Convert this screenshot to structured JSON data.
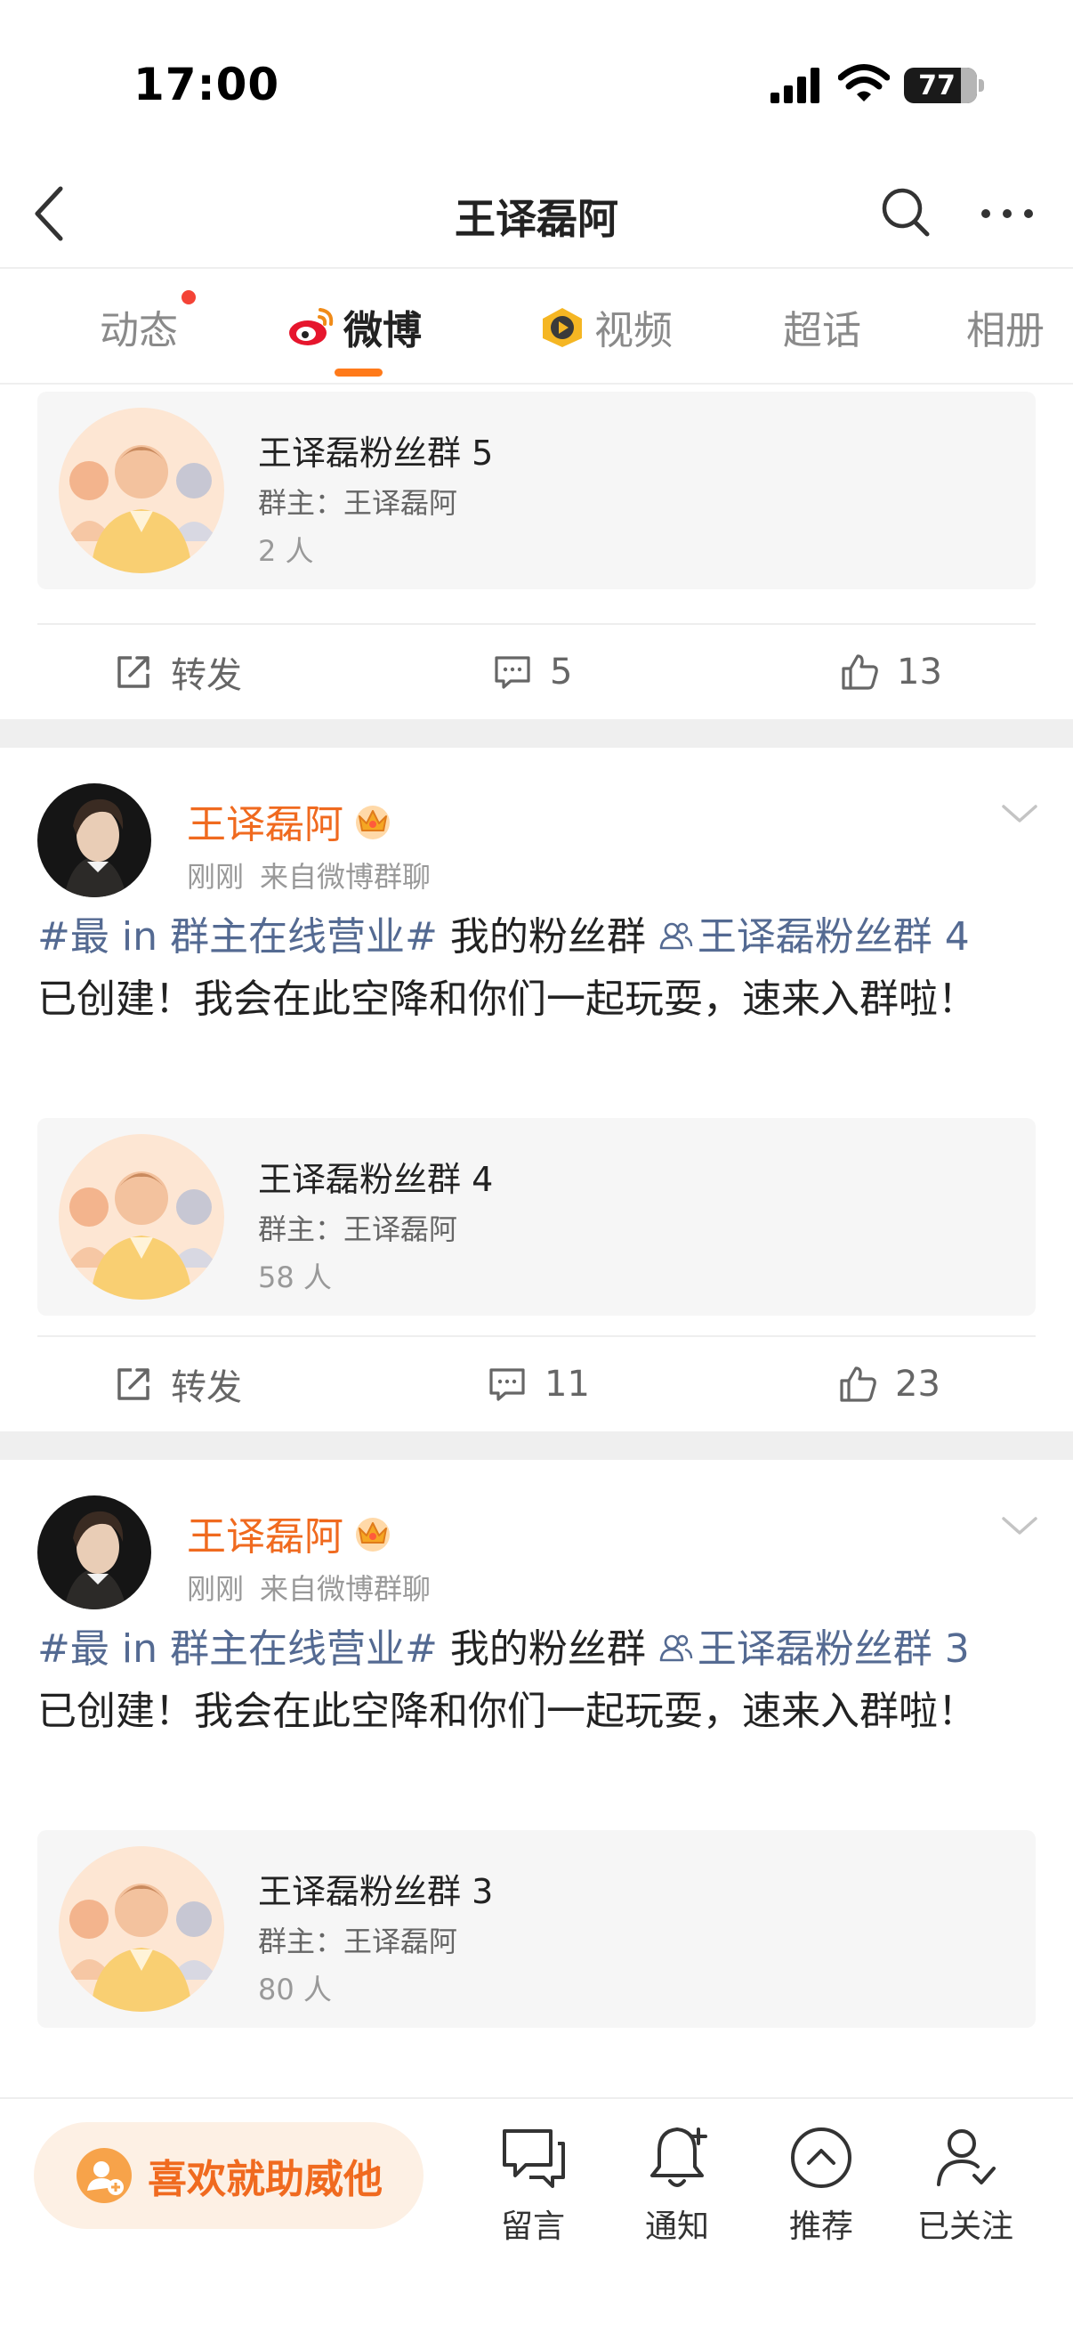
{
  "status_bar": {
    "time": "17:00",
    "battery": "77"
  },
  "header": {
    "title": "王译磊阿"
  },
  "tabs": [
    {
      "label": "动态",
      "has_dot": true
    },
    {
      "label": "微博",
      "active": true
    },
    {
      "label": "视频"
    },
    {
      "label": "超话"
    },
    {
      "label": "相册"
    }
  ],
  "posts": [
    {
      "group": {
        "name": "王译磊粉丝群 5",
        "owner": "群主：王译磊阿",
        "count": "2 人"
      },
      "actions": {
        "repost": "转发",
        "comments": "5",
        "likes": "13"
      }
    },
    {
      "author": "王译磊阿",
      "time": "刚刚",
      "source": "来自微博群聊",
      "topic": "#最 in 群主在线营业#",
      "text_before": " 我的粉丝群 ",
      "group_link": "王译磊粉丝群 4",
      "text_after": "已创建！我会在此空降和你们一起玩耍，速来入群啦！",
      "group": {
        "name": "王译磊粉丝群 4",
        "owner": "群主：王译磊阿",
        "count": "58 人"
      },
      "actions": {
        "repost": "转发",
        "comments": "11",
        "likes": "23"
      }
    },
    {
      "author": "王译磊阿",
      "time": "刚刚",
      "source": "来自微博群聊",
      "topic": "#最 in 群主在线营业#",
      "text_before": " 我的粉丝群 ",
      "group_link": "王译磊粉丝群 3",
      "text_after": "已创建！我会在此空降和你们一起玩耍，速来入群啦！",
      "group": {
        "name": "王译磊粉丝群 3",
        "owner": "群主：王译磊阿",
        "count": "80 人"
      }
    }
  ],
  "bottom_bar": {
    "support_label": "喜欢就助威他",
    "items": [
      {
        "label": "留言",
        "icon": "message-icon"
      },
      {
        "label": "通知",
        "icon": "bell-plus-icon"
      },
      {
        "label": "推荐",
        "icon": "chevron-up-circle-icon"
      },
      {
        "label": "已关注",
        "icon": "user-check-icon"
      }
    ]
  },
  "colors": {
    "accent": "#f06a1f",
    "link": "#546a92",
    "tab_underline": "#ff7a1a"
  }
}
